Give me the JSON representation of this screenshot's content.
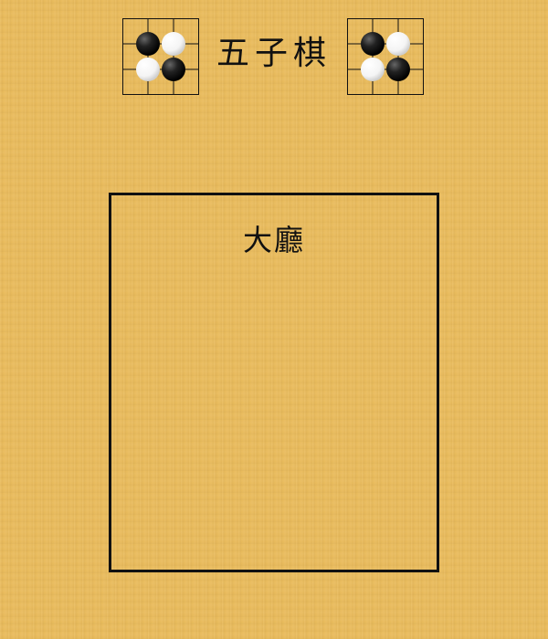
{
  "header": {
    "title": "五子棋",
    "logo_icon": "gomoku-board-icon"
  },
  "lobby": {
    "title": "大廳"
  },
  "colors": {
    "background": "#e9bb5c",
    "border": "#111111",
    "stone_black": "#111111",
    "stone_white": "#ffffff"
  }
}
